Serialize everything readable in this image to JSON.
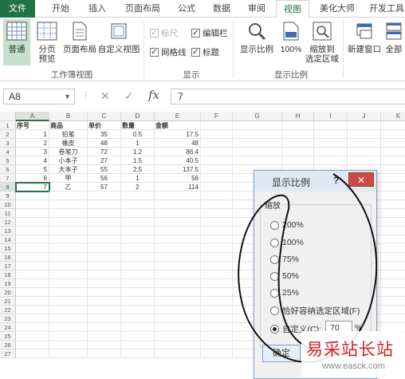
{
  "ribbon_tabs": [
    "文件",
    "开始",
    "插入",
    "页面布局",
    "公式",
    "数据",
    "审阅",
    "视图",
    "美化大师",
    "开发工具"
  ],
  "active_tab": "视图",
  "accent_color": "#217346",
  "workbook_views": {
    "normal": "普通",
    "page_break": "分页\n预览",
    "page_layout": "页面布局",
    "custom_views": "自定义视图",
    "group_label": "工作簿视图"
  },
  "show": {
    "ruler": "标尺",
    "formula_bar": "编辑栏",
    "gridlines": "网格线",
    "headings": "标题",
    "group_label": "显示",
    "ruler_checked": true,
    "formula_bar_checked": true,
    "gridlines_checked": true,
    "headings_checked": true
  },
  "zoom_group": {
    "zoom": "显示比例",
    "hundred": "100%",
    "zoom_to_selection": "缩放到\n选定区域",
    "group_label": "显示比例"
  },
  "window_group": {
    "new_window": "新建窗口",
    "arrange_all": "全部"
  },
  "formula_bar": {
    "name_box": "A8",
    "cancel_symbol": "✕",
    "enter_symbol": "✓",
    "fx_symbol": "fx",
    "value": "7"
  },
  "columns": [
    "A",
    "B",
    "C",
    "D",
    "E",
    "F",
    "G",
    "H",
    "I",
    "J",
    "K"
  ],
  "rows": [
    "1",
    "2",
    "3",
    "4",
    "5",
    "6",
    "7",
    "8",
    "9",
    "10",
    "11",
    "12",
    "13",
    "14",
    "15",
    "16",
    "17",
    "18",
    "19",
    "20",
    "21",
    "22",
    "23",
    "24",
    "25",
    "26",
    "27"
  ],
  "table": {
    "headers": [
      "序号",
      "商品",
      "单价",
      "数量",
      "金额"
    ],
    "data": [
      [
        "1",
        "铅笔",
        "35",
        "0.5",
        "17.5"
      ],
      [
        "2",
        "橡皮",
        "48",
        "1",
        "48"
      ],
      [
        "3",
        "卷笔刀",
        "72",
        "1.2",
        "86.4"
      ],
      [
        "4",
        "小本子",
        "27",
        "1.5",
        "40.5"
      ],
      [
        "5",
        "大本子",
        "55",
        "2.5",
        "137.5"
      ],
      [
        "6",
        "甲",
        "56",
        "1",
        "56"
      ],
      [
        "7",
        "乙",
        "57",
        "2",
        "114"
      ]
    ]
  },
  "zoom_dialog": {
    "title": "显示比例",
    "help": "?",
    "close": "✕",
    "legend": "缩放",
    "options": [
      "200%",
      "100%",
      "75%",
      "50%",
      "25%",
      "恰好容纳选定区域(F)",
      "自定义(C):"
    ],
    "custom_value": "70",
    "percent_sign": "%",
    "ok": "确定",
    "selected_index": 6
  },
  "watermark": {
    "cn": "易采站长站",
    "url": "www.easck.com"
  }
}
